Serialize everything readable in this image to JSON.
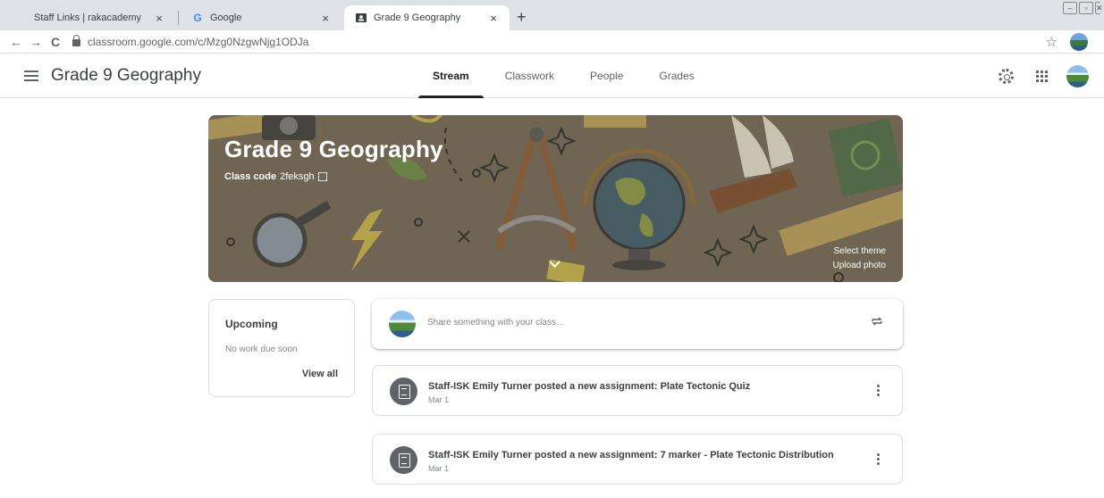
{
  "browser": {
    "tabs": [
      {
        "title": "Staff Links | rakacademy",
        "close": "×"
      },
      {
        "title": "Google",
        "favicon": "G",
        "close": "×"
      },
      {
        "title": "Grade 9 Geography",
        "close": "×"
      }
    ],
    "new_tab": "+",
    "url": "classroom.google.com/c/Mzg0NzgwNjg1ODJa",
    "nav": {
      "back": "←",
      "forward": "→",
      "reload": "C"
    },
    "star": "☆"
  },
  "app": {
    "title": "Grade 9 Geography",
    "tabs": [
      "Stream",
      "Classwork",
      "People",
      "Grades"
    ],
    "active_tab": "Stream"
  },
  "banner": {
    "title": "Grade 9 Geography",
    "class_code_label": "Class code",
    "class_code": "2feksgh",
    "select_theme": "Select theme",
    "upload_photo": "Upload photo"
  },
  "upcoming": {
    "heading": "Upcoming",
    "empty_text": "No work due soon",
    "view_all": "View all"
  },
  "share": {
    "placeholder": "Share something with your class..."
  },
  "posts": [
    {
      "text": "Staff-ISK Emily Turner posted a new assignment: Plate Tectonic Quiz",
      "date": "Mar 1"
    },
    {
      "text": "Staff-ISK Emily Turner posted a new assignment: 7 marker - Plate Tectonic Distribution",
      "date": "Mar 1"
    }
  ],
  "colors": {
    "banner_bg": "#6f6552",
    "text_primary": "#202124",
    "text_secondary": "#5f6368"
  }
}
